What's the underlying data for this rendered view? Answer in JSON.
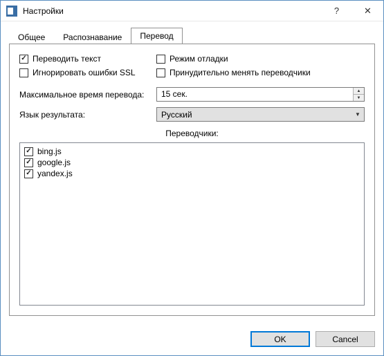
{
  "window": {
    "title": "Настройки"
  },
  "tabs": {
    "general": "Общее",
    "recognition": "Распознавание",
    "translation": "Перевод"
  },
  "checks": {
    "translate_text": "Переводить текст",
    "debug_mode": "Режим отладки",
    "ignore_ssl": "Игнорировать ошибки SSL",
    "force_rotate": "Принудительно менять переводчики"
  },
  "labels": {
    "max_translate_time": "Максимальное время перевода:",
    "result_language": "Язык результата:",
    "translators": "Переводчики:"
  },
  "values": {
    "max_translate_time": "15 сек.",
    "result_language": "Русский"
  },
  "translators": [
    {
      "name": "bing.js",
      "checked": true
    },
    {
      "name": "google.js",
      "checked": true
    },
    {
      "name": "yandex.js",
      "checked": true
    }
  ],
  "buttons": {
    "ok": "OK",
    "cancel": "Cancel"
  }
}
